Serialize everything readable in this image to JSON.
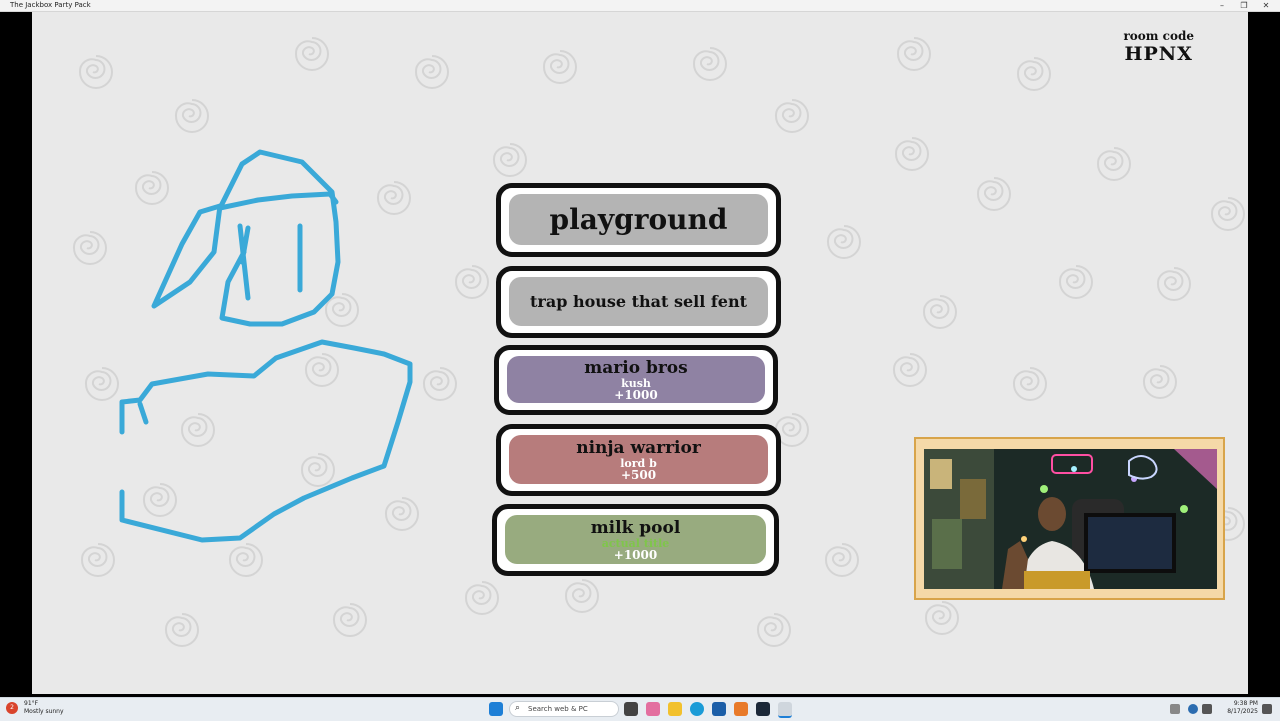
{
  "window": {
    "title": "The Jackbox Party Pack",
    "minimize": "–",
    "restore": "❐",
    "close": "✕"
  },
  "game": {
    "room_label": "room code",
    "room_code": "HPNX",
    "answers": [
      {
        "text": "playground",
        "color": "#b4b4b4"
      },
      {
        "text": "trap house that sell fent",
        "color": "#b4b4b4"
      },
      {
        "text": "mario bros",
        "player": "kush",
        "points": "+1000",
        "color": "#8f82a3"
      },
      {
        "text": "ninja warrior",
        "player": "lord b",
        "points": "+500",
        "color": "#b77c7c"
      },
      {
        "text": "milk pool",
        "player": "actual title",
        "points": "+1000",
        "color": "#98ab7f",
        "player_color": "#7fc64a"
      }
    ]
  },
  "taskbar": {
    "temperature": "91°F",
    "weather": "Mostly sunny",
    "search_placeholder": "Search web & PC",
    "time": "9:38 PM",
    "date": "8/17/2025",
    "notification_count": "2"
  },
  "colors": {
    "drawing_stroke": "#3aa9d8",
    "background": "#e9e9e9",
    "webcam_frame": "#d8a44a"
  }
}
